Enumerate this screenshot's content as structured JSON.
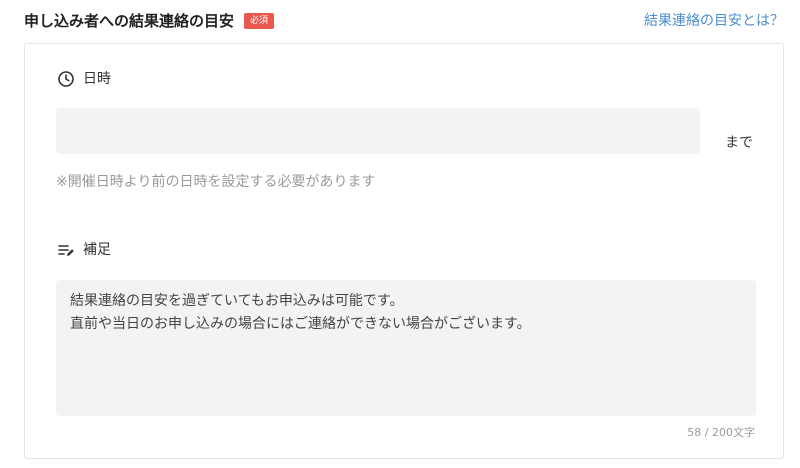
{
  "section": {
    "title": "申し込み者への結果連絡の目安",
    "required_badge": "必須",
    "help_link": "結果連絡の目安とは？"
  },
  "datetime_field": {
    "label": "日時",
    "icon": "clock-icon",
    "value": "",
    "suffix": "まで",
    "hint": "※開催日時より前の日時を設定する必要があります"
  },
  "supplement_field": {
    "label": "補足",
    "icon": "notes-edit-icon",
    "value": "結果連絡の目安を過ぎていてもお申込みは可能です。\n直前や当日のお申し込みの場合にはご連絡ができない場合がございます。",
    "char_count": "58 / 200文字"
  },
  "colors": {
    "badge": "#e8584f",
    "link": "#4b8fd0",
    "input_bg": "#f2f3f5",
    "hint": "#9a9a9a"
  }
}
